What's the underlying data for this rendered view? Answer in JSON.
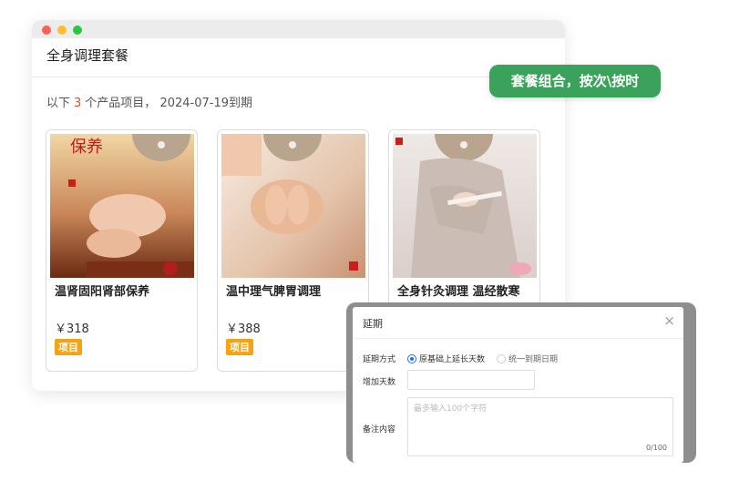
{
  "window": {
    "title": "全身调理套餐",
    "summary": {
      "prefix": "以下",
      "count": "3",
      "middle": "个产品项目，",
      "expiry": "2024-07-19到期"
    }
  },
  "products": [
    {
      "name": "温肾固阳肾部保养",
      "price": "￥318",
      "tag": "项目",
      "photo_text": "保养"
    },
    {
      "name": "温中理气脾胃调理",
      "price": "￥388",
      "tag": "项目"
    },
    {
      "name": "全身针灸调理 温经散寒",
      "price": "",
      "tag": ""
    }
  ],
  "badge": {
    "text": "套餐组合，按次\\按时"
  },
  "dialog": {
    "title": "延期",
    "close_icon": "close-icon",
    "mode_label": "延期方式",
    "mode_options": [
      {
        "label": "原基础上延长天数",
        "selected": true
      },
      {
        "label": "统一到期日期",
        "selected": false
      }
    ],
    "days_label": "增加天数",
    "days_value": "",
    "note_label": "备注内容",
    "note_placeholder": "最多输入100个字符",
    "note_count": "0/100"
  },
  "colors": {
    "accent_badge": "#3aa25a",
    "count_red": "#e84c1a",
    "tag_orange": "#f5a213",
    "radio_blue": "#1e6ff0"
  }
}
